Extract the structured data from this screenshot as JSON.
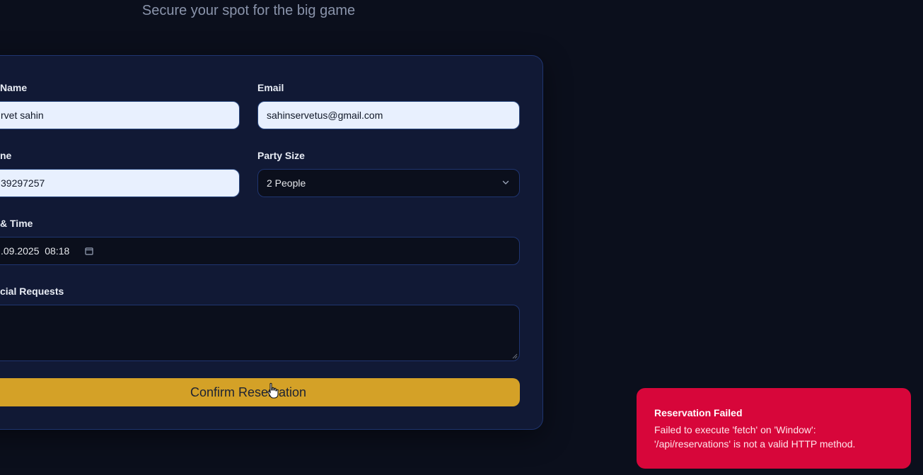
{
  "header": {
    "subtitle": "Secure your spot for the big game"
  },
  "form": {
    "name": {
      "label": "Name",
      "value": "rvet sahin"
    },
    "email": {
      "label": "Email",
      "value": "sahinservetus@gmail.com"
    },
    "phone": {
      "label": "ne",
      "value": "39297257"
    },
    "party_size": {
      "label": "Party Size",
      "selected": "2 People"
    },
    "datetime": {
      "label": "& Time",
      "value": ".09.2025  08:18"
    },
    "requests": {
      "label": "cial Requests",
      "value": ""
    },
    "submit_label": "Confirm Reservation"
  },
  "toast": {
    "title": "Reservation Failed",
    "message_line1": "Failed to execute 'fetch' on 'Window':",
    "message_line2": "'/api/reservations' is not a valid HTTP method.",
    "color": "#d7063a"
  },
  "colors": {
    "background": "#0b0f1c",
    "card": "#111935",
    "accent": "#d4a127",
    "border": "#1f3570"
  },
  "icons": [
    "chevron-down-icon",
    "calendar-icon",
    "resize-grip-icon",
    "pointer-cursor-icon"
  ]
}
